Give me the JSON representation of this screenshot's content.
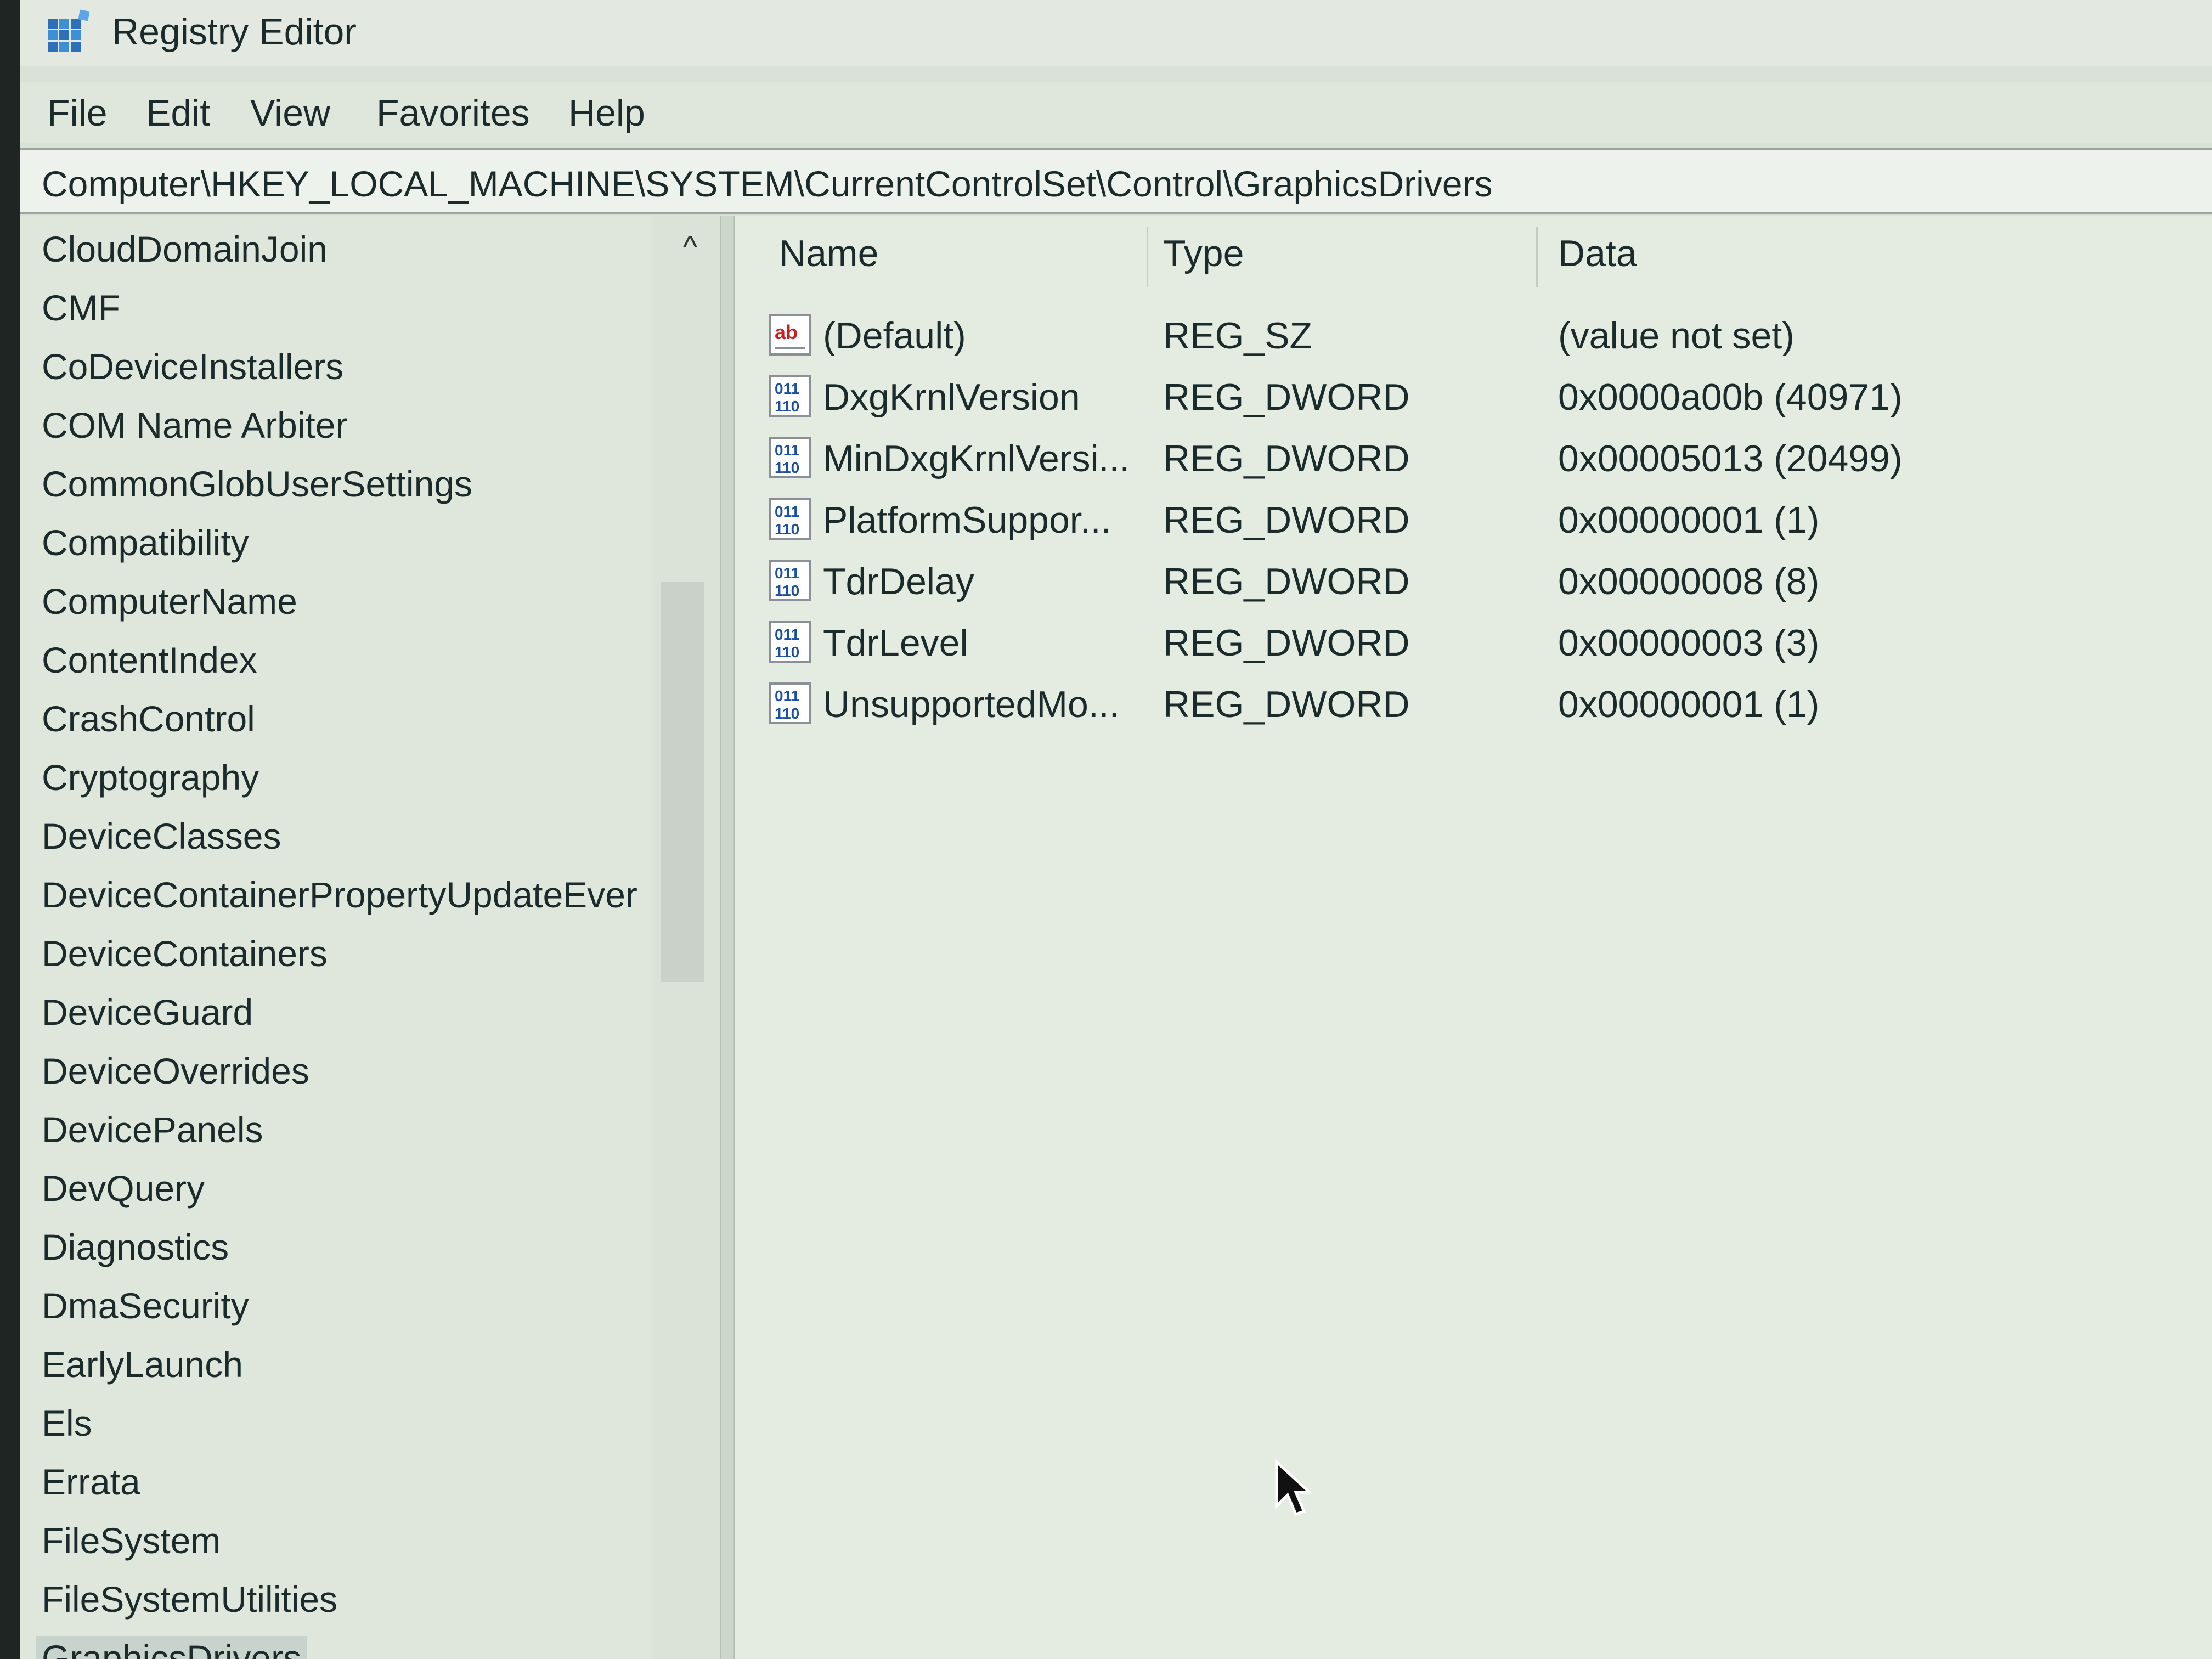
{
  "window": {
    "title": "Registry Editor",
    "icon": "registry-editor-icon"
  },
  "menu": {
    "items": [
      "File",
      "Edit",
      "View",
      "Favorites",
      "Help"
    ]
  },
  "address": {
    "path": "Computer\\HKEY_LOCAL_MACHINE\\SYSTEM\\CurrentControlSet\\Control\\GraphicsDrivers"
  },
  "tree": {
    "items": [
      "CloudDomainJoin",
      "CMF",
      "CoDeviceInstallers",
      "COM Name Arbiter",
      "CommonGlobUserSettings",
      "Compatibility",
      "ComputerName",
      "ContentIndex",
      "CrashControl",
      "Cryptography",
      "DeviceClasses",
      "DeviceContainerPropertyUpdateEver",
      "DeviceContainers",
      "DeviceGuard",
      "DeviceOverrides",
      "DevicePanels",
      "DevQuery",
      "Diagnostics",
      "DmaSecurity",
      "EarlyLaunch",
      "Els",
      "Errata",
      "FileSystem",
      "FileSystemUtilities",
      "GraphicsDrivers"
    ],
    "selected": "GraphicsDrivers"
  },
  "values": {
    "columns": {
      "name": "Name",
      "type": "Type",
      "data": "Data"
    },
    "rows": [
      {
        "icon": "string-value-icon",
        "name": "(Default)",
        "type": "REG_SZ",
        "data": "(value not set)"
      },
      {
        "icon": "binary-value-icon",
        "name": "DxgKrnlVersion",
        "type": "REG_DWORD",
        "data": "0x0000a00b (40971)"
      },
      {
        "icon": "binary-value-icon",
        "name": "MinDxgKrnlVersi...",
        "type": "REG_DWORD",
        "data": "0x00005013 (20499)"
      },
      {
        "icon": "binary-value-icon",
        "name": "PlatformSuppor...",
        "type": "REG_DWORD",
        "data": "0x00000001 (1)"
      },
      {
        "icon": "binary-value-icon",
        "name": "TdrDelay",
        "type": "REG_DWORD",
        "data": "0x00000008 (8)"
      },
      {
        "icon": "binary-value-icon",
        "name": "TdrLevel",
        "type": "REG_DWORD",
        "data": "0x00000003 (3)"
      },
      {
        "icon": "binary-value-icon",
        "name": "UnsupportedMo...",
        "type": "REG_DWORD",
        "data": "0x00000001 (1)"
      }
    ]
  }
}
